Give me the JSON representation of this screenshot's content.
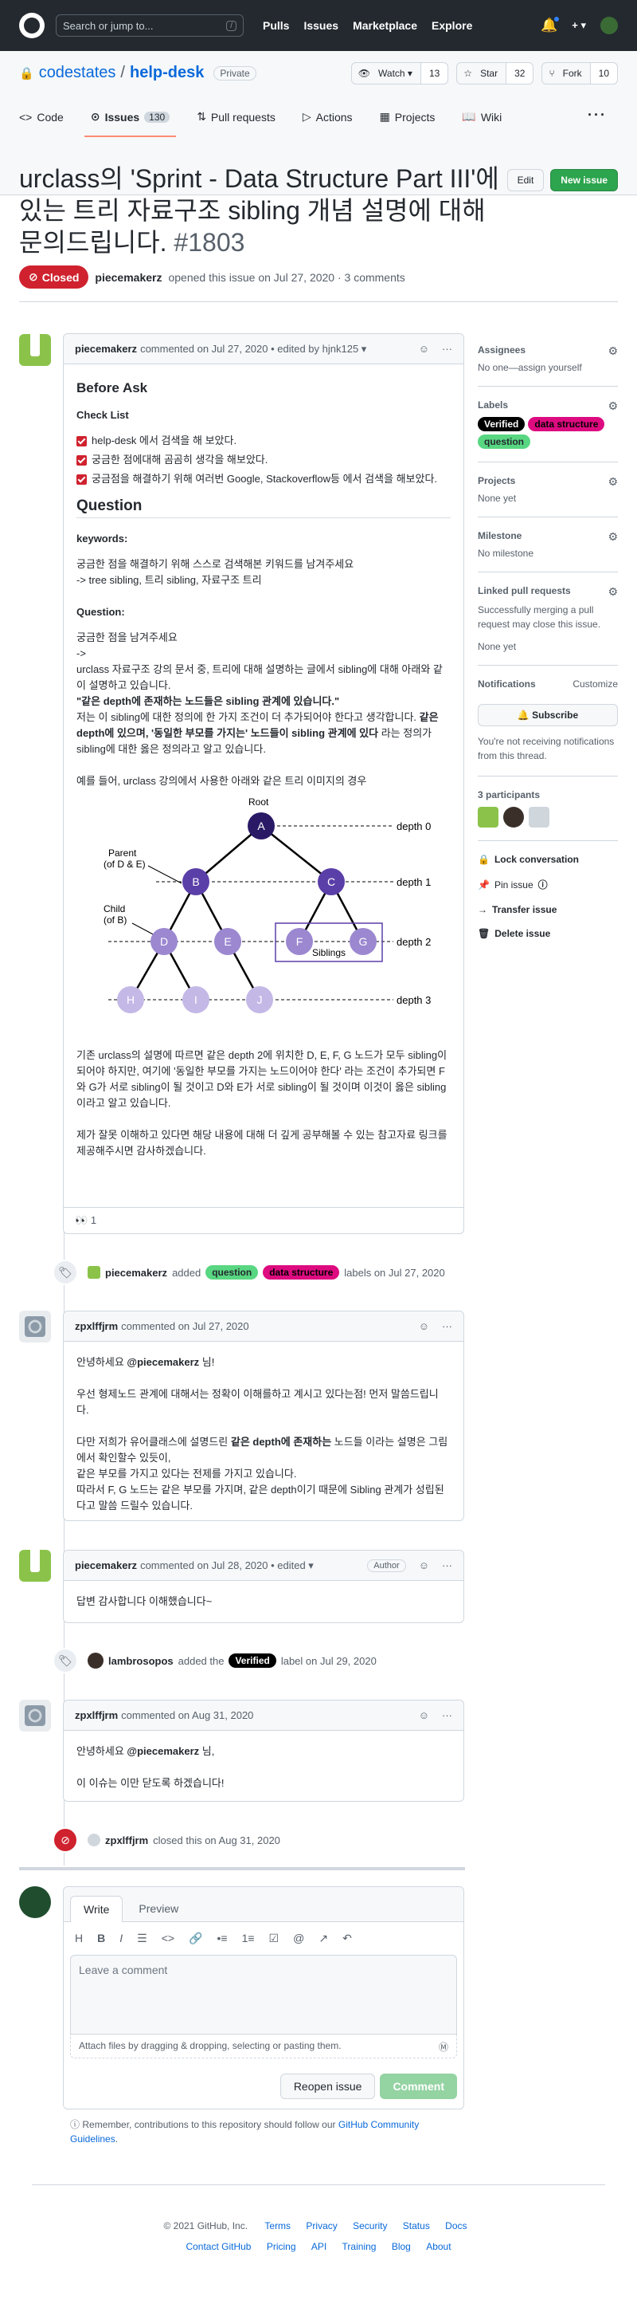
{
  "header": {
    "search_placeholder": "Search or jump to...",
    "slash_key": "/",
    "nav": [
      "Pulls",
      "Issues",
      "Marketplace",
      "Explore"
    ],
    "plus": "+ ▾"
  },
  "repo": {
    "owner": "codestates",
    "sep": "/",
    "name": "help-desk",
    "visibility": "Private",
    "watch_label": "Watch ▾",
    "watch_count": "13",
    "star_label": "Star",
    "star_count": "32",
    "fork_label": "Fork",
    "fork_count": "10",
    "tabs": [
      {
        "label": "Code"
      },
      {
        "label": "Issues",
        "count": "130"
      },
      {
        "label": "Pull requests"
      },
      {
        "label": "Actions"
      },
      {
        "label": "Projects"
      },
      {
        "label": "Wiki"
      }
    ],
    "more": "···"
  },
  "issue": {
    "title": "urclass의 'Sprint - Data Structure Part III'에 있는 트리 자료구조 sibling 개념 설명에 대해 문의드립니다.",
    "number": "#1803",
    "edit_button": "Edit",
    "new_issue_button": "New issue",
    "state": "Closed",
    "author": "piecemakerz",
    "meta": "opened this issue on Jul 27, 2020 · 3 comments"
  },
  "comment1": {
    "author": "piecemakerz",
    "meta": "commented on Jul 27, 2020 • edited by hjnk125 ▾",
    "h_before": "Before Ask",
    "h_checklist": "Check List",
    "checks": [
      "help-desk 에서 검색을 해 보았다.",
      "궁금한 점에대해 곰곰히 생각을 해보았다.",
      "궁금점을 해결하기 위해 여러번 Google, Stackoverflow등 에서 검색을 해보았다."
    ],
    "h_question": "Question",
    "keywords_h": "keywords:",
    "keywords_1": "궁금한 점을 해결하기 위해 스스로 검색해본 키워드를 남겨주세요",
    "keywords_2": "-> tree sibling, 트리 sibling, 자료구조 트리",
    "question_h": "Question:",
    "q1": "궁금한 점을 남겨주세요",
    "q2": "->",
    "q3": "urclass 자료구조 강의 문서 중, 트리에 대해 설명하는 글에서 sibling에 대해 아래와 같이 설명하고 있습니다.",
    "q4": "\"같은 depth에 존재하는 노드들은 sibling 관계에 있습니다.\"",
    "q5a": "저는 이 sibling에 대한 정의에 한 가지 조건이 더 추가되어야 한다고 생각합니다. ",
    "q5b": "같은 depth에 있으며, '동일한 부모를 가지는' 노드들이 sibling 관계에 있다",
    "q5c": " 라는 정의가 sibling에 대한 옳은 정의라고 알고 있습니다.",
    "q6": "예를 들어, urclass 강의에서 사용한 아래와 같은 트리 이미지의 경우",
    "q7": "기존 urclass의 설명에 따르면 같은 depth 2에 위치한 D, E, F, G 노드가 모두 sibling이 되어야 하지만, 여기에 '동일한 부모를 가지는 노드이어야 한다' 라는 조건이 추가되면 F와 G가 서로 sibling이 될 것이고 D와 E가 서로 sibling이 될 것이며 이것이 옳은 sibling이라고 알고 있습니다.",
    "q8": "제가 잘못 이해하고 있다면 해당 내용에 대해 더 깊게 공부해볼 수 있는 참고자료 링크를 제공해주시면 감사하겠습니다.",
    "reaction_emoji": "👀",
    "reaction_count": "1"
  },
  "tree": {
    "root": "Root",
    "parent": "Parent",
    "parent_of": "(of D & E)",
    "child": "Child",
    "child_of": "(of B)",
    "siblings": "Siblings",
    "nodes": [
      "A",
      "B",
      "C",
      "D",
      "E",
      "F",
      "G",
      "H",
      "I",
      "J"
    ],
    "depths": [
      "depth 0",
      "depth 1",
      "depth 2",
      "depth 3"
    ]
  },
  "event1": {
    "author": "piecemakerz",
    "added": "added",
    "labels": [
      "question",
      "data structure"
    ],
    "tail": "labels on Jul 27, 2020"
  },
  "comment2": {
    "author": "zpxlffjrm",
    "meta": "commented on Jul 27, 2020",
    "greeting_a": "안녕하세요 ",
    "greeting_mention": "@piecemakerz",
    "greeting_b": " 님!",
    "p1": "우선 형제노드 관계에 대해서는 정확이 이해를하고 계시고 있다는점! 먼저 말씀드립니다.",
    "p2a": "다만 저희가 유어클래스에 설명드린 ",
    "p2b": "같은 depth에 존재하는",
    "p2c": " 노드들 이라는 설명은 그림에서 확인할수 있듯이,",
    "p3": "같은 부모를 가지고 있다는 전제를 가지고 있습니다.",
    "p4": "따라서 F, G 노드는 같은 부모를 가지며, 같은 depth이기 때문에 Sibling 관계가 성립된다고 말씀 드릴수 있습니다."
  },
  "comment3": {
    "author": "piecemakerz",
    "meta": "commented on Jul 28, 2020 • edited ▾",
    "badge": "Author",
    "body": "답변 감사합니다 이해했습니다~"
  },
  "event2": {
    "author": "lambrosopos",
    "added": "added the",
    "label": "Verified",
    "tail": "label on Jul 29, 2020"
  },
  "comment4": {
    "author": "zpxlffjrm",
    "meta": "commented on Aug 31, 2020",
    "greeting_a": "안녕하세요 ",
    "greeting_mention": "@piecemakerz",
    "greeting_b": " 님,",
    "body": "이 이슈는 이만 닫도록 하겠습니다!"
  },
  "event3": {
    "author": "zpxlffjrm",
    "tail": "closed this on Aug 31, 2020"
  },
  "editor": {
    "tab_write": "Write",
    "tab_preview": "Preview",
    "placeholder": "Leave a comment",
    "attach": "Attach files by dragging & dropping, selecting or pasting them.",
    "reopen": "Reopen issue",
    "comment": "Comment"
  },
  "remember": {
    "text": "Remember, contributions to this repository should follow our ",
    "link": "GitHub Community Guidelines",
    "end": "."
  },
  "sidebar": {
    "assignees_h": "Assignees",
    "assignees_v": "No one—assign yourself",
    "labels_h": "Labels",
    "labels": [
      "Verified",
      "data structure",
      "question"
    ],
    "projects_h": "Projects",
    "projects_v": "None yet",
    "milestone_h": "Milestone",
    "milestone_v": "No milestone",
    "linked_h": "Linked pull requests",
    "linked_desc": "Successfully merging a pull request may close this issue.",
    "linked_v": "None yet",
    "notif_h": "Notifications",
    "customize": "Customize",
    "subscribe": "Subscribe",
    "notif_desc": "You're not receiving notifications from this thread.",
    "participants": "3 participants",
    "actions": [
      "Lock conversation",
      "Pin issue",
      "Transfer issue",
      "Delete issue"
    ]
  },
  "footer": {
    "copyright": "© 2021 GitHub, Inc.",
    "row1": [
      "Terms",
      "Privacy",
      "Security",
      "Status",
      "Docs"
    ],
    "row2": [
      "Contact GitHub",
      "Pricing",
      "API",
      "Training",
      "Blog",
      "About"
    ]
  },
  "colors": {
    "closed": "#cf222e",
    "green": "#2da44e",
    "verified": "#000000",
    "data_structure": "#dd0b7f",
    "question": "#58d681",
    "tree_dark": "#2a1a66",
    "tree_mid": "#5b3fa8",
    "tree_light": "#9b88d0",
    "tree_lighter": "#c4b8e6"
  }
}
